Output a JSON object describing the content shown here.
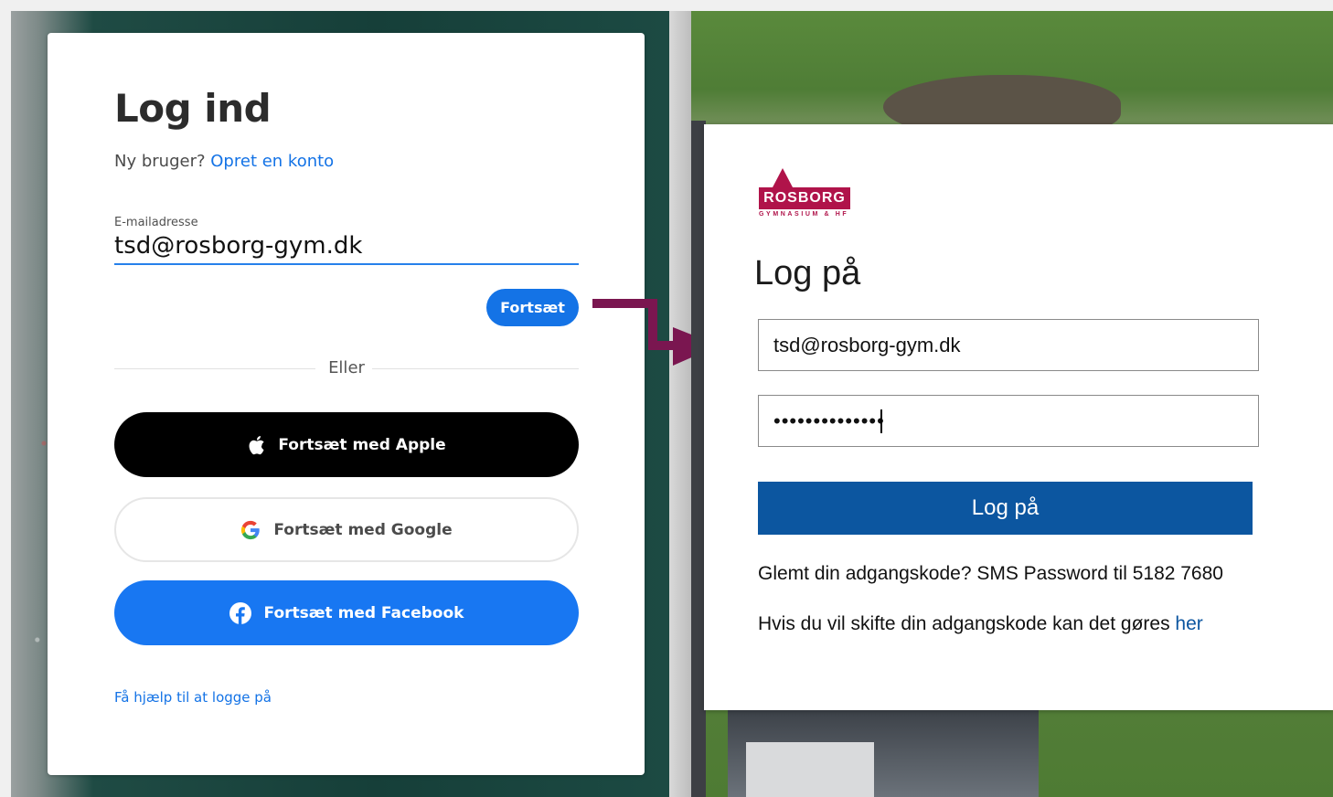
{
  "adobe": {
    "title": "Log ind",
    "new_user_prefix": "Ny bruger?",
    "create_account_link": "Opret en konto",
    "email_label": "E-mailadresse",
    "email_value": "tsd@rosborg-gym.dk",
    "continue_button": "Fortsæt",
    "divider_text": "Eller",
    "apple_button": "Fortsæt med Apple",
    "google_button": "Fortsæt med Google",
    "facebook_button": "Fortsæt med Facebook",
    "help_link": "Få hjælp til at logge på"
  },
  "rosborg": {
    "logo_name": "ROSBORG",
    "logo_subtitle": "GYMNASIUM & HF",
    "title": "Log på",
    "username_value": "tsd@rosborg-gym.dk",
    "password_masked": "••••••••••••••",
    "submit_button": "Log på",
    "forgot_text": "Glemt din adgangskode? SMS Password til 5182 7680",
    "change_text": "Hvis du vil skifte din adgangskode kan det gøres",
    "change_link": "her"
  },
  "colors": {
    "adobe_blue": "#1473e6",
    "facebook_blue": "#1877f2",
    "rosborg_brand": "#b0134a",
    "ms_blue": "#0c56a0",
    "arrow": "#7a1650"
  }
}
